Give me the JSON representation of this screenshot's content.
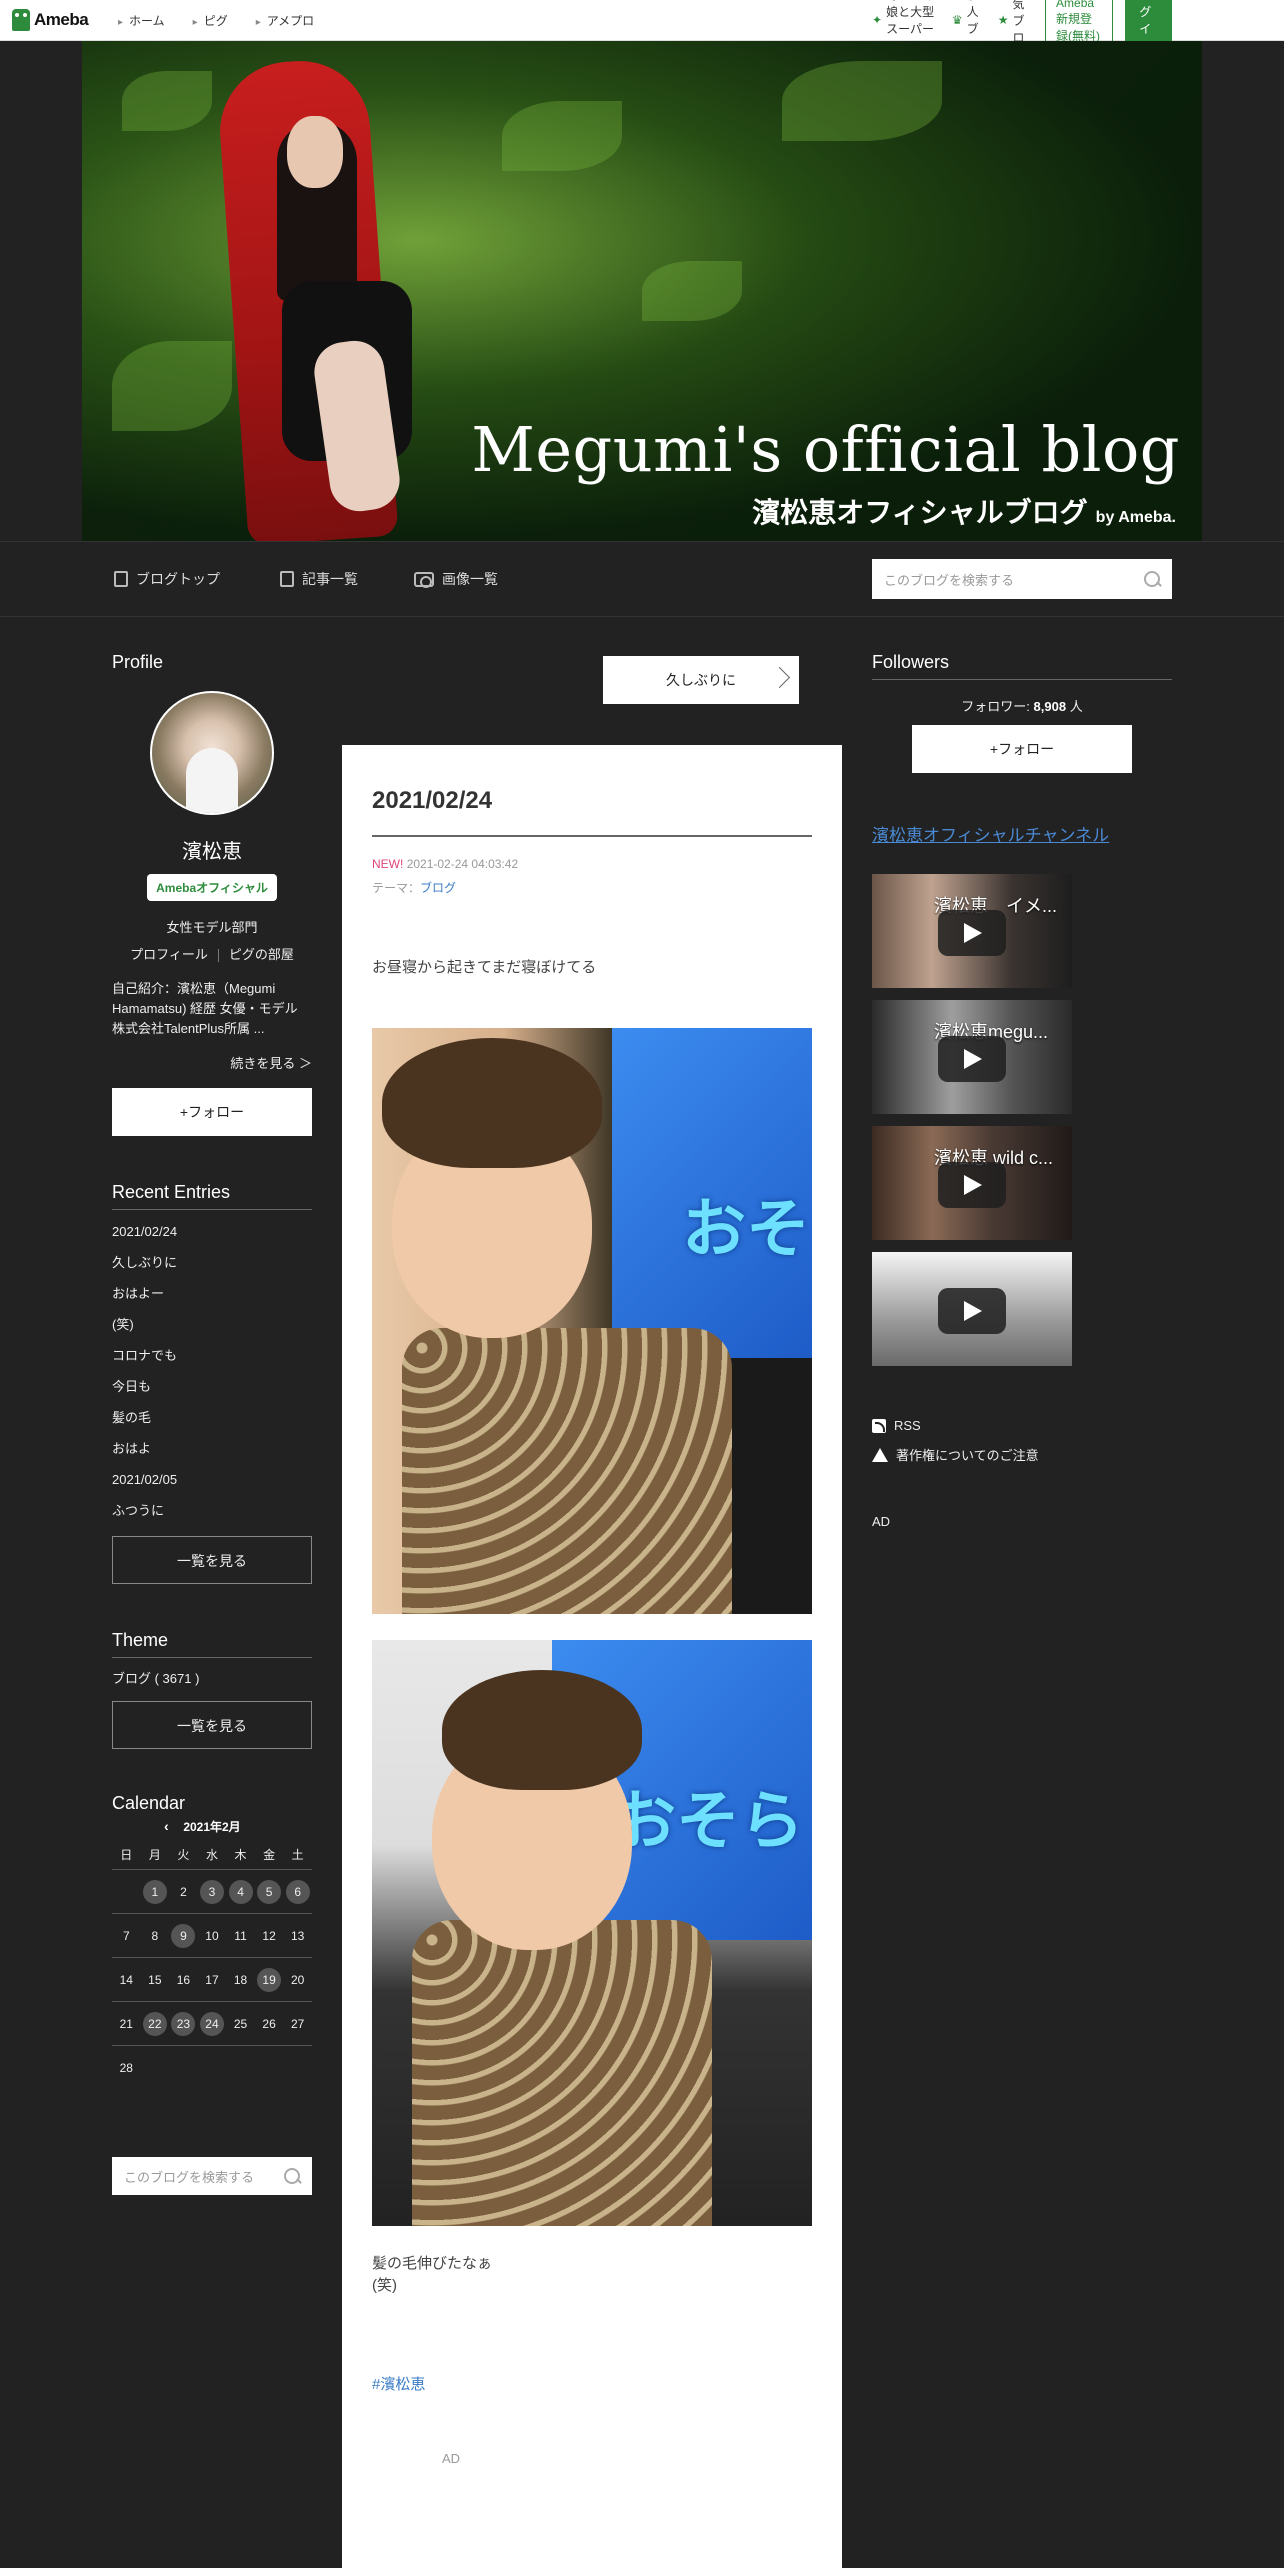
{
  "topnav": {
    "brand": "Ameba",
    "links": [
      "ホーム",
      "ピグ",
      "アメプロ"
    ],
    "right_links": [
      "野口五郎 娘と大型スーパーへ",
      "芸能人ブログ",
      "人気ブログ"
    ],
    "signup": "Ameba新規登録(無料)",
    "login": "ログイン"
  },
  "header": {
    "title": "Megumi's official blog",
    "subtitle": "濱松恵オフィシャルブログ",
    "by": "by Ameba."
  },
  "blognav": {
    "items": [
      "ブログトップ",
      "記事一覧",
      "画像一覧"
    ],
    "search_placeholder": "このブログを検索する"
  },
  "profile": {
    "section_title": "Profile",
    "name": "濱松恵",
    "badge": "Amebaオフィシャル",
    "category": "女性モデル部門",
    "link_profile": "プロフィール",
    "link_pig": "ピグの部屋",
    "intro": "自己紹介：濱松恵（Megumi Hamamatsu) 経歴 女優・モデル 株式会社TalentPlus所属 ...",
    "more": "続きを見る ＞",
    "follow": "+フォロー"
  },
  "recent": {
    "title": "Recent Entries",
    "items": [
      "2021/02/24",
      "久しぶりに",
      "おはよー",
      "(笑)",
      "コロナでも",
      "今日も",
      "髪の毛",
      "おはよ",
      "2021/02/05",
      "ふつうに"
    ],
    "more": "一覧を見る"
  },
  "theme": {
    "title": "Theme",
    "item": "ブログ ( 3671 )",
    "more": "一覧を見る"
  },
  "calendar": {
    "title": "Calendar",
    "month": "2021年2月",
    "weekdays": [
      "日",
      "月",
      "火",
      "水",
      "木",
      "金",
      "土"
    ],
    "weeks": [
      [
        "",
        "1",
        "2",
        "3",
        "4",
        "5",
        "6"
      ],
      [
        "7",
        "8",
        "9",
        "10",
        "11",
        "12",
        "13"
      ],
      [
        "14",
        "15",
        "16",
        "17",
        "18",
        "19",
        "20"
      ],
      [
        "21",
        "22",
        "23",
        "24",
        "25",
        "26",
        "27"
      ],
      [
        "28",
        "",
        "",
        "",
        "",
        "",
        ""
      ]
    ],
    "highlighted": [
      "1",
      "3",
      "4",
      "5",
      "6",
      "9",
      "19",
      "22",
      "23",
      "24"
    ]
  },
  "left_search": {
    "placeholder": "このブログを検索する"
  },
  "article": {
    "prev_post": "久しぶりに",
    "title": "2021/02/24",
    "new_label": "NEW!",
    "datetime": "2021-02-24 04:03:42",
    "theme_label": "テーマ：",
    "theme_value": "ブログ",
    "body": "お昼寝から起きてまだ寝ぼけてる",
    "caption_line1": "髪の毛伸びたなぁ",
    "caption_line2": "(笑)",
    "hashtag": "#濱松恵",
    "ad": "AD"
  },
  "followers": {
    "title": "Followers",
    "label": "フォロワー:",
    "count": "8,908",
    "unit": "人",
    "follow": "+フォロー"
  },
  "channel": {
    "link": "濱松恵オフィシャルチャンネル",
    "videos": [
      "濱松恵　イメ...",
      "濱松恵megu...",
      "濱松恵 wild c...",
      ""
    ]
  },
  "utils": {
    "rss": "RSS",
    "copyright": "著作権についてのご注意",
    "ad": "AD"
  },
  "colors": {
    "page_bg": "#222222",
    "accent_green": "#2d8c3c",
    "link_blue": "#3a7bc8",
    "new_pink": "#e0457b"
  }
}
